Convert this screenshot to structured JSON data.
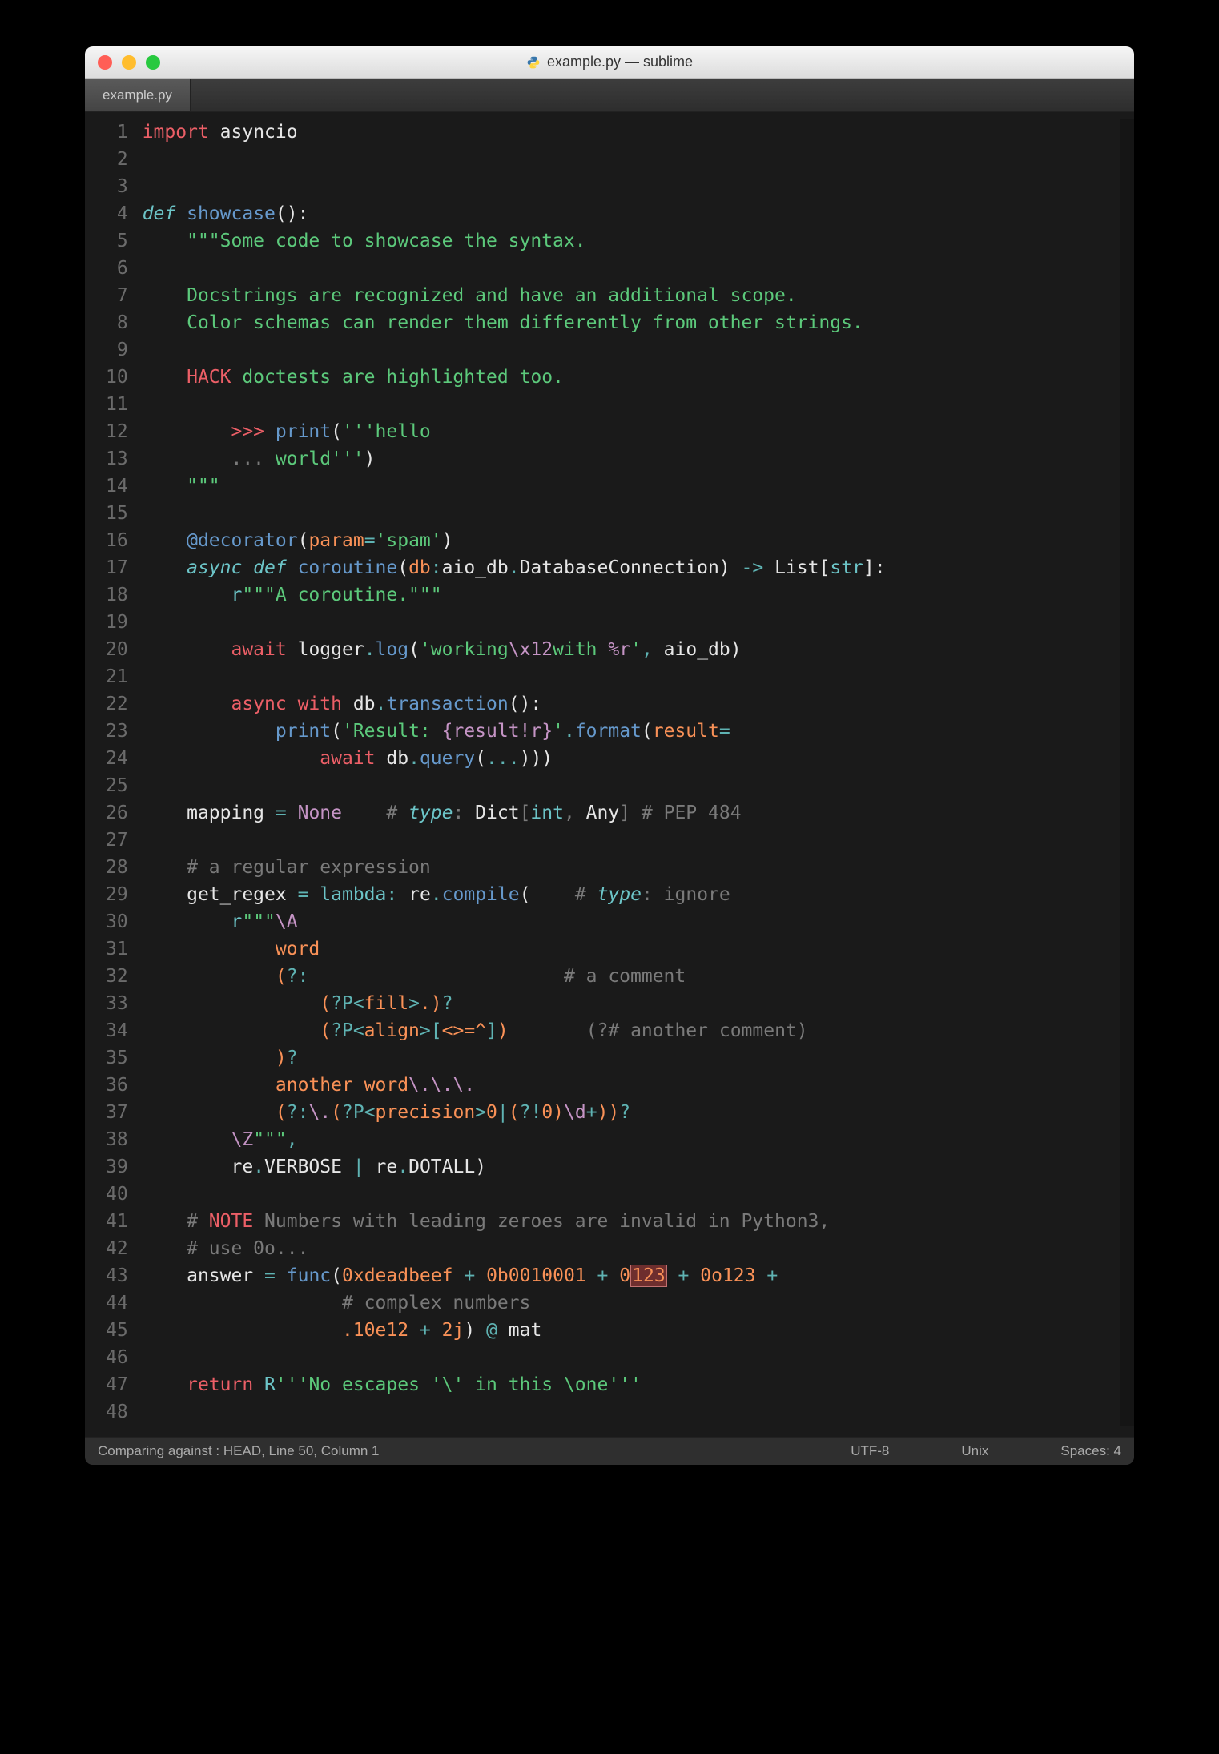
{
  "window": {
    "title": "example.py — sublime",
    "traffic": {
      "close": "close",
      "min": "minimize",
      "max": "zoom"
    }
  },
  "tabs": [
    {
      "label": "example.py",
      "active": true
    }
  ],
  "gutter": {
    "start": 1,
    "end": 48
  },
  "code_lines": [
    [
      [
        "kw-red",
        "import"
      ],
      [
        "fg",
        " "
      ],
      [
        "white",
        "asyncio"
      ]
    ],
    [],
    [],
    [
      [
        "cyan italic",
        "def"
      ],
      [
        "fg",
        " "
      ],
      [
        "blue",
        "showcase"
      ],
      [
        "white",
        "():"
      ]
    ],
    [
      [
        "fg",
        "    "
      ],
      [
        "green",
        "\"\"\"Some code to showcase the syntax."
      ]
    ],
    [],
    [
      [
        "fg",
        "    "
      ],
      [
        "green",
        "Docstrings are recognized and have an additional scope."
      ]
    ],
    [
      [
        "fg",
        "    "
      ],
      [
        "green",
        "Color schemas can render them differently from other strings."
      ]
    ],
    [],
    [
      [
        "fg",
        "    "
      ],
      [
        "kw-red",
        "HACK"
      ],
      [
        "green",
        " doctests are highlighted too."
      ]
    ],
    [],
    [
      [
        "fg",
        "        "
      ],
      [
        "kw-red",
        ">>>"
      ],
      [
        "fg",
        " "
      ],
      [
        "blue",
        "print"
      ],
      [
        "white",
        "("
      ],
      [
        "green",
        "'''hello"
      ]
    ],
    [
      [
        "fg",
        "        "
      ],
      [
        "comment",
        "..."
      ],
      [
        "green",
        " world'''"
      ],
      [
        "white",
        ")"
      ]
    ],
    [
      [
        "fg",
        "    "
      ],
      [
        "green",
        "\"\"\""
      ]
    ],
    [],
    [
      [
        "fg",
        "    "
      ],
      [
        "blue",
        "@decorator"
      ],
      [
        "white",
        "("
      ],
      [
        "orange",
        "param"
      ],
      [
        "teal",
        "="
      ],
      [
        "green",
        "'spam'"
      ],
      [
        "white",
        ")"
      ]
    ],
    [
      [
        "fg",
        "    "
      ],
      [
        "cyan italic",
        "async def"
      ],
      [
        "fg",
        " "
      ],
      [
        "blue",
        "coroutine"
      ],
      [
        "white",
        "("
      ],
      [
        "orange",
        "db"
      ],
      [
        "teal",
        ":"
      ],
      [
        "white",
        "aio_db"
      ],
      [
        "teal",
        "."
      ],
      [
        "white",
        "DatabaseConnection) "
      ],
      [
        "teal",
        "->"
      ],
      [
        "fg",
        " "
      ],
      [
        "white",
        "List["
      ],
      [
        "cyan",
        "str"
      ],
      [
        "white",
        "]:"
      ]
    ],
    [
      [
        "fg",
        "        "
      ],
      [
        "cyan",
        "r"
      ],
      [
        "green",
        "\"\"\"A coroutine.\"\"\""
      ]
    ],
    [],
    [
      [
        "fg",
        "        "
      ],
      [
        "kw-red",
        "await"
      ],
      [
        "fg",
        " "
      ],
      [
        "white",
        "logger"
      ],
      [
        "teal",
        "."
      ],
      [
        "blue",
        "log"
      ],
      [
        "white",
        "("
      ],
      [
        "green",
        "'working"
      ],
      [
        "purple",
        "\\x12"
      ],
      [
        "green",
        "with "
      ],
      [
        "purple",
        "%r"
      ],
      [
        "green",
        "'"
      ],
      [
        "teal",
        ","
      ],
      [
        "fg",
        " "
      ],
      [
        "white",
        "aio_db)"
      ]
    ],
    [],
    [
      [
        "fg",
        "        "
      ],
      [
        "kw-red",
        "async with"
      ],
      [
        "fg",
        " "
      ],
      [
        "white",
        "db"
      ],
      [
        "teal",
        "."
      ],
      [
        "blue",
        "transaction"
      ],
      [
        "white",
        "():"
      ]
    ],
    [
      [
        "fg",
        "            "
      ],
      [
        "blue",
        "print"
      ],
      [
        "white",
        "("
      ],
      [
        "green",
        "'Result: "
      ],
      [
        "purple",
        "{result!r}"
      ],
      [
        "green",
        "'"
      ],
      [
        "teal",
        "."
      ],
      [
        "blue",
        "format"
      ],
      [
        "white",
        "("
      ],
      [
        "orange",
        "result"
      ],
      [
        "teal",
        "="
      ]
    ],
    [
      [
        "fg",
        "                "
      ],
      [
        "kw-red",
        "await"
      ],
      [
        "fg",
        " "
      ],
      [
        "white",
        "db"
      ],
      [
        "teal",
        "."
      ],
      [
        "blue",
        "query"
      ],
      [
        "white",
        "("
      ],
      [
        "teal",
        "..."
      ],
      [
        "white",
        ")))"
      ]
    ],
    [],
    [
      [
        "fg",
        "    "
      ],
      [
        "white",
        "mapping "
      ],
      [
        "teal",
        "="
      ],
      [
        "fg",
        " "
      ],
      [
        "purple",
        "None"
      ],
      [
        "fg",
        "    "
      ],
      [
        "comment",
        "# "
      ],
      [
        "cyan italic",
        "type"
      ],
      [
        "comment",
        ": "
      ],
      [
        "white",
        "Dict"
      ],
      [
        "comment",
        "["
      ],
      [
        "cyan",
        "int"
      ],
      [
        "comment",
        ", "
      ],
      [
        "white",
        "Any"
      ],
      [
        "comment",
        "] # PEP 484"
      ]
    ],
    [],
    [
      [
        "fg",
        "    "
      ],
      [
        "comment",
        "# a regular expression"
      ]
    ],
    [
      [
        "fg",
        "    "
      ],
      [
        "white",
        "get_regex "
      ],
      [
        "teal",
        "="
      ],
      [
        "fg",
        " "
      ],
      [
        "cyan",
        "lambda"
      ],
      [
        "teal",
        ":"
      ],
      [
        "fg",
        " "
      ],
      [
        "white",
        "re"
      ],
      [
        "teal",
        "."
      ],
      [
        "blue",
        "compile"
      ],
      [
        "white",
        "("
      ],
      [
        "fg",
        "    "
      ],
      [
        "comment",
        "# "
      ],
      [
        "cyan italic",
        "type"
      ],
      [
        "comment",
        ": ignore"
      ]
    ],
    [
      [
        "fg",
        "        "
      ],
      [
        "cyan",
        "r"
      ],
      [
        "green",
        "\"\"\""
      ],
      [
        "purple",
        "\\A"
      ]
    ],
    [
      [
        "fg",
        "            "
      ],
      [
        "orange",
        "word"
      ]
    ],
    [
      [
        "fg",
        "            "
      ],
      [
        "orange",
        "("
      ],
      [
        "teal",
        "?:"
      ],
      [
        "fg",
        "                       "
      ],
      [
        "comment",
        "# a comment"
      ]
    ],
    [
      [
        "fg",
        "                "
      ],
      [
        "orange",
        "("
      ],
      [
        "teal",
        "?P<"
      ],
      [
        "orange",
        "fill"
      ],
      [
        "teal",
        ">"
      ],
      [
        "orange",
        ".)"
      ],
      [
        "teal",
        "?"
      ]
    ],
    [
      [
        "fg",
        "                "
      ],
      [
        "orange",
        "("
      ],
      [
        "teal",
        "?P<"
      ],
      [
        "orange",
        "align"
      ],
      [
        "teal",
        ">"
      ],
      [
        "teal",
        "["
      ],
      [
        "orange",
        "<>=^"
      ],
      [
        "teal",
        "]"
      ],
      [
        "orange",
        ")"
      ],
      [
        "fg",
        "       "
      ],
      [
        "comment",
        "(?# another comment)"
      ]
    ],
    [
      [
        "fg",
        "            "
      ],
      [
        "orange",
        ")"
      ],
      [
        "teal",
        "?"
      ]
    ],
    [
      [
        "fg",
        "            "
      ],
      [
        "orange",
        "another word"
      ],
      [
        "purple",
        "\\."
      ],
      [
        "purple",
        "\\."
      ],
      [
        "purple",
        "\\."
      ]
    ],
    [
      [
        "fg",
        "            "
      ],
      [
        "orange",
        "("
      ],
      [
        "teal",
        "?:"
      ],
      [
        "purple",
        "\\."
      ],
      [
        "orange",
        "("
      ],
      [
        "teal",
        "?P<"
      ],
      [
        "orange",
        "precision"
      ],
      [
        "teal",
        ">"
      ],
      [
        "orange",
        "0"
      ],
      [
        "teal",
        "|"
      ],
      [
        "orange",
        "("
      ],
      [
        "teal",
        "?!"
      ],
      [
        "orange",
        "0)"
      ],
      [
        "purple",
        "\\d"
      ],
      [
        "teal",
        "+"
      ],
      [
        "orange",
        "))"
      ],
      [
        "teal",
        "?"
      ]
    ],
    [
      [
        "fg",
        "        "
      ],
      [
        "purple",
        "\\Z"
      ],
      [
        "green",
        "\"\"\""
      ],
      [
        "teal",
        ","
      ]
    ],
    [
      [
        "fg",
        "        "
      ],
      [
        "white",
        "re"
      ],
      [
        "teal",
        "."
      ],
      [
        "white",
        "VERBOSE "
      ],
      [
        "teal",
        "|"
      ],
      [
        "fg",
        " "
      ],
      [
        "white",
        "re"
      ],
      [
        "teal",
        "."
      ],
      [
        "white",
        "DOTALL)"
      ]
    ],
    [],
    [
      [
        "fg",
        "    "
      ],
      [
        "comment",
        "# "
      ],
      [
        "kw-red",
        "NOTE"
      ],
      [
        "comment",
        " Numbers with leading zeroes are invalid in Python3,"
      ]
    ],
    [
      [
        "fg",
        "    "
      ],
      [
        "comment",
        "# use 0o..."
      ]
    ],
    [
      [
        "fg",
        "    "
      ],
      [
        "white",
        "answer "
      ],
      [
        "teal",
        "="
      ],
      [
        "fg",
        " "
      ],
      [
        "blue",
        "func"
      ],
      [
        "white",
        "("
      ],
      [
        "orange",
        "0xdeadbeef"
      ],
      [
        "fg",
        " "
      ],
      [
        "teal",
        "+"
      ],
      [
        "fg",
        " "
      ],
      [
        "orange",
        "0b0010001"
      ],
      [
        "fg",
        " "
      ],
      [
        "teal",
        "+"
      ],
      [
        "fg",
        " "
      ],
      [
        "orange",
        "0"
      ],
      [
        "err-box",
        "123"
      ],
      [
        "fg",
        " "
      ],
      [
        "teal",
        "+"
      ],
      [
        "fg",
        " "
      ],
      [
        "orange",
        "0o123"
      ],
      [
        "fg",
        " "
      ],
      [
        "teal",
        "+"
      ]
    ],
    [
      [
        "fg",
        "                  "
      ],
      [
        "comment",
        "# complex numbers"
      ]
    ],
    [
      [
        "fg",
        "                  "
      ],
      [
        "orange",
        ".10e12"
      ],
      [
        "fg",
        " "
      ],
      [
        "teal",
        "+"
      ],
      [
        "fg",
        " "
      ],
      [
        "orange",
        "2j"
      ],
      [
        "white",
        ") "
      ],
      [
        "teal",
        "@"
      ],
      [
        "fg",
        " "
      ],
      [
        "white",
        "mat"
      ]
    ],
    [],
    [
      [
        "fg",
        "    "
      ],
      [
        "kw-red",
        "return"
      ],
      [
        "fg",
        " "
      ],
      [
        "cyan",
        "R"
      ],
      [
        "green",
        "'''No escapes '\\' in this \\one'''"
      ]
    ],
    []
  ],
  "statusbar": {
    "left": "Comparing against : HEAD, Line 50, Column 1",
    "encoding": "UTF-8",
    "line_endings": "Unix",
    "indent": "Spaces: 4"
  }
}
